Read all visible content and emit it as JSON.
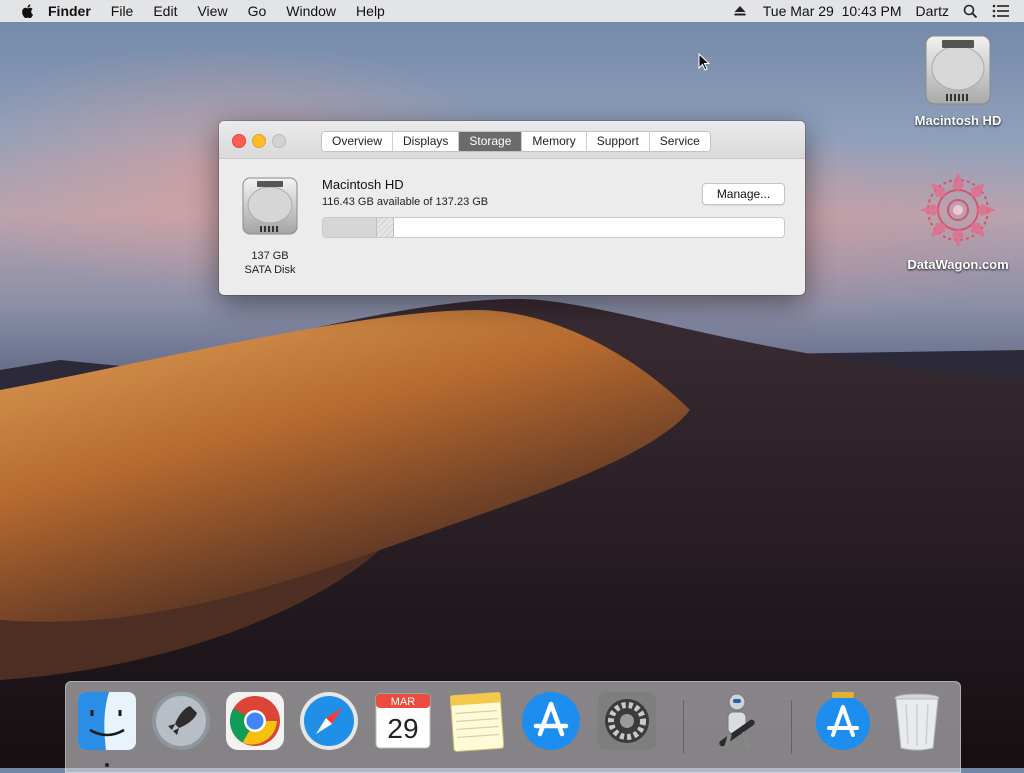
{
  "menubar": {
    "app_name": "Finder",
    "menus": [
      "File",
      "Edit",
      "View",
      "Go",
      "Window",
      "Help"
    ],
    "clock": "Tue Mar 29  10:43 PM",
    "user": "Dartz"
  },
  "desktop": {
    "icons": [
      {
        "label": "Macintosh HD",
        "icon": "hard-drive-icon"
      },
      {
        "label": "DataWagon.com",
        "icon": "mandala-logo-icon"
      }
    ]
  },
  "window": {
    "tabs": [
      {
        "label": "Overview"
      },
      {
        "label": "Displays"
      },
      {
        "label": "Storage",
        "active": true
      },
      {
        "label": "Memory"
      },
      {
        "label": "Support"
      },
      {
        "label": "Service"
      }
    ],
    "disk": {
      "size": "137 GB",
      "type": "SATA Disk"
    },
    "volume": {
      "name": "Macintosh HD",
      "available": "116.43 GB available of 137.23 GB",
      "used_fraction": 0.116,
      "purgeable_fraction": 0.035
    },
    "manage_label": "Manage..."
  },
  "calendar": {
    "month": "MAR",
    "day": "29"
  },
  "dock": {
    "apps": [
      "Finder",
      "Launchpad",
      "Google Chrome",
      "Safari",
      "Calendar",
      "Notes",
      "App Store",
      "System Preferences",
      "Automator",
      "App Store Downloads",
      "Trash"
    ]
  },
  "colors": {
    "close": "#fd5f57",
    "minimize": "#febc2e",
    "zoom": "#d3d3d3",
    "active_tab": "#6b6b6b"
  }
}
